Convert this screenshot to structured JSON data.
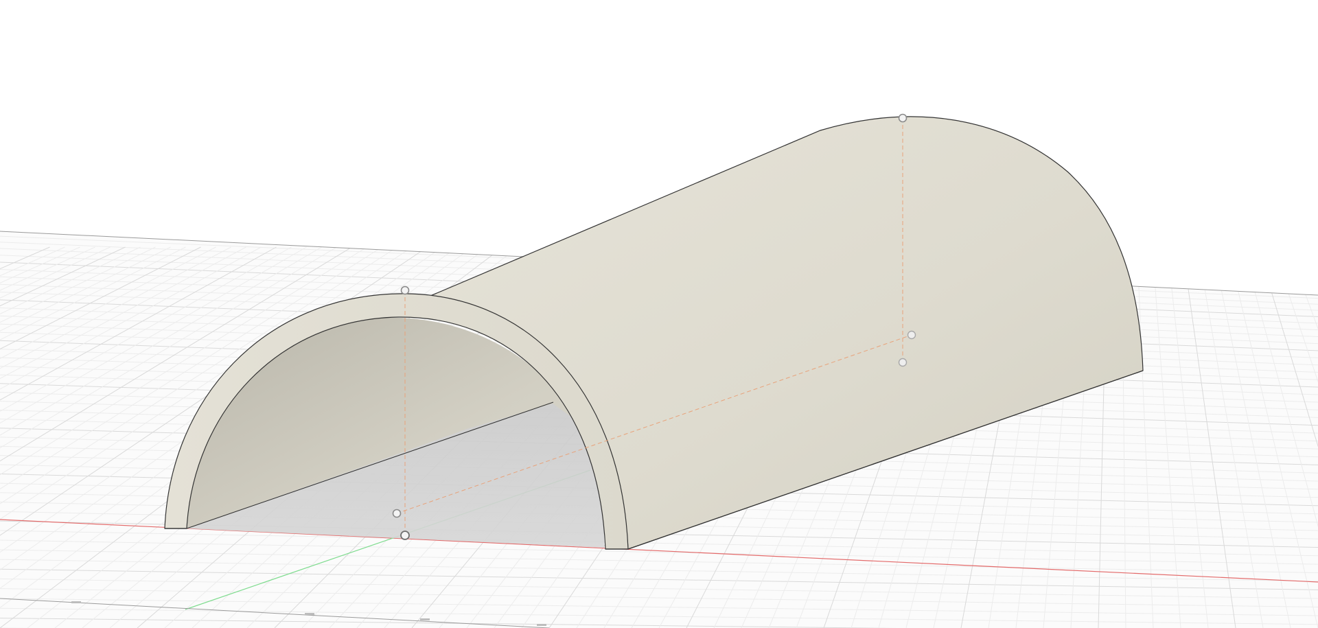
{
  "viewport": {
    "background_color": "#ffffff",
    "view_mode": "perspective",
    "grid": {
      "visible": true,
      "major_line_color": "#d9d9d9",
      "minor_line_color": "#ececec",
      "edge_color": "#8c8c8c"
    },
    "axes": {
      "x_axis_color": "#e36a6a",
      "y_axis_color": "#7fdc8f"
    },
    "ruler_marks": [
      "",
      "",
      "",
      ""
    ]
  },
  "model": {
    "body_name": "",
    "shape": "half-tube",
    "surface_color": "#e2dfd4",
    "edge_color": "#333333",
    "sketch_line_color": "#e8a27a",
    "sketch_point_count": 6
  }
}
